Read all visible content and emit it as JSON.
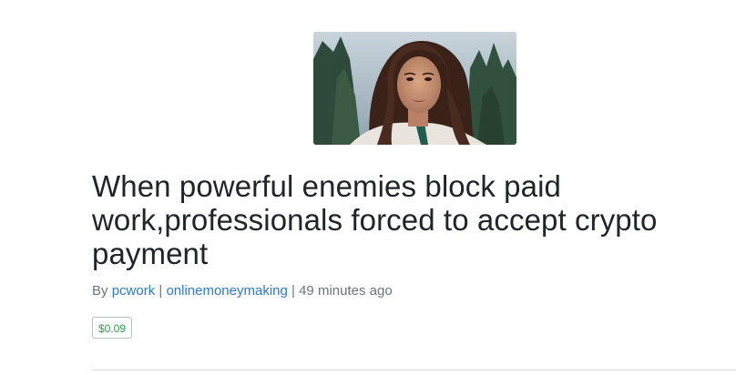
{
  "post": {
    "image_alt": "woman portrait thumbnail",
    "title": "When powerful enemies block paid work,professionals forced to accept crypto payment",
    "meta": {
      "by_prefix": "By ",
      "author": "pcwork",
      "separator1": " | ",
      "category": "onlinemoneymaking",
      "separator2": " | ",
      "time_ago": "49 minutes ago"
    },
    "payout_badge": "$0.09"
  }
}
